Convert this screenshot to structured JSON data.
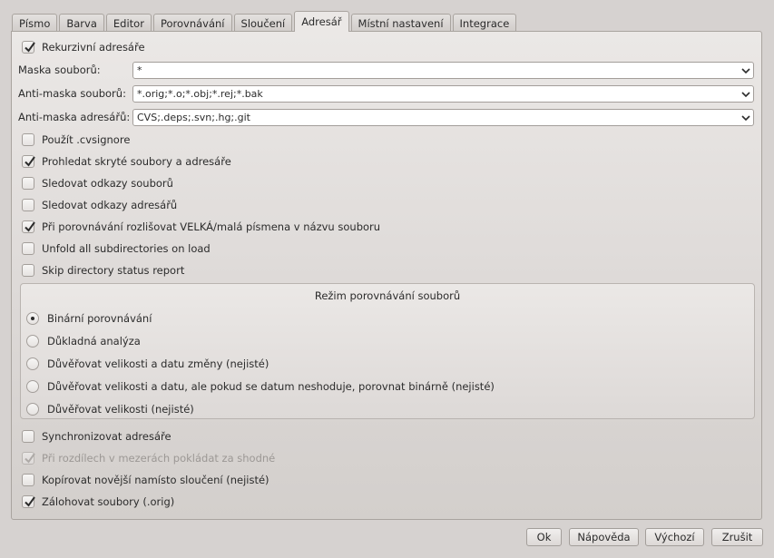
{
  "tabs": [
    "Písmo",
    "Barva",
    "Editor",
    "Porovnávání",
    "Sloučení",
    "Adresář",
    "Místní nastavení",
    "Integrace"
  ],
  "active_tab": "Adresář",
  "recursive_dirs": {
    "label": "Rekurzivní adresáře",
    "checked": true
  },
  "fields": {
    "file_mask_label": "Maska souborů:",
    "file_mask_value": "*",
    "file_antimask_label": "Anti-maska souborů:",
    "file_antimask_value": "*.orig;*.o;*.obj;*.rej;*.bak",
    "dir_antimask_label": "Anti-maska adresářů:",
    "dir_antimask_value": "CVS;.deps;.svn;.hg;.git"
  },
  "options": [
    {
      "label": "Použít .cvsignore",
      "checked": false
    },
    {
      "label": "Prohledat skryté soubory a adresáře",
      "checked": true
    },
    {
      "label": "Sledovat odkazy souborů",
      "checked": false
    },
    {
      "label": "Sledovat odkazy adresářů",
      "checked": false
    },
    {
      "label": "Při porovnávání rozlišovat VELKÁ/malá písmena v názvu souboru",
      "checked": true
    },
    {
      "label": "Unfold all subdirectories on load",
      "checked": false
    },
    {
      "label": "Skip directory status report",
      "checked": false
    }
  ],
  "compare_mode": {
    "title": "Režim porovnávání souborů",
    "options": [
      "Binární porovnávání",
      "Důkladná analýza",
      "Důvěřovat velikosti a datu změny (nejisté)",
      "Důvěřovat velikosti a datu, ale pokud se datum neshoduje, porovnat binárně (nejisté)",
      "Důvěřovat velikosti (nejisté)"
    ],
    "selected": "Binární porovnávání"
  },
  "bottom_options": [
    {
      "label": "Synchronizovat adresáře",
      "checked": false,
      "disabled": false
    },
    {
      "label": "Při rozdílech v mezerách pokládat za shodné",
      "checked": true,
      "disabled": true
    },
    {
      "label": "Kopírovat novější namísto sloučení (nejisté)",
      "checked": false,
      "disabled": false
    },
    {
      "label": "Zálohovat soubory (.orig)",
      "checked": true,
      "disabled": false
    }
  ],
  "buttons": {
    "ok": "Ok",
    "help": "Nápověda",
    "defaults": "Výchozí",
    "cancel": "Zrušit"
  }
}
